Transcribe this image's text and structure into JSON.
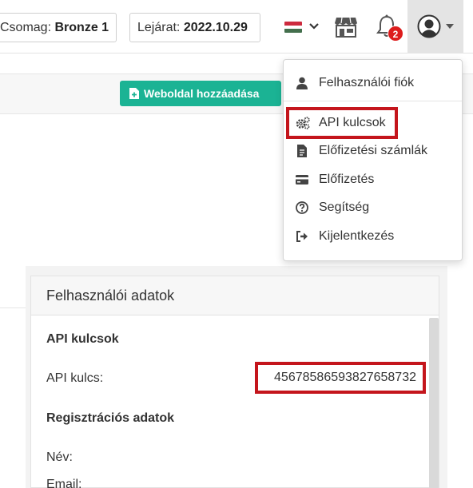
{
  "header": {
    "package_label": "Csomag:",
    "package_value": "Bronze 1",
    "expiry_label": "Lejárat:",
    "expiry_value": "2022.10.29",
    "notification_count": "2",
    "flag_colors": [
      "#cd2a3e",
      "#ffffff",
      "#436f4d"
    ]
  },
  "toolbar": {
    "add_website_label": "Weboldal hozzáadása"
  },
  "user_menu": {
    "items": [
      {
        "label": "Felhasználói fiók",
        "icon": "user-icon"
      },
      {
        "label": "API kulcsok",
        "icon": "cogs-icon"
      },
      {
        "label": "Előfizetési számlák",
        "icon": "invoice-icon"
      },
      {
        "label": "Előfizetés",
        "icon": "credit-card-icon"
      },
      {
        "label": "Segítség",
        "icon": "question-icon"
      },
      {
        "label": "Kijelentkezés",
        "icon": "sign-out-icon"
      }
    ]
  },
  "panel": {
    "title": "Felhasználói adatok",
    "api_section_title": "API kulcsok",
    "api_key_label": "API kulcs:",
    "api_key_value": "45678586593827658732",
    "registration_section_title": "Regisztrációs adatok",
    "name_label": "Név:",
    "email_label": "Email:"
  },
  "colors": {
    "accent_green": "#1bb394",
    "highlight_red": "#c4151c",
    "badge_red": "#dd1c1c"
  }
}
